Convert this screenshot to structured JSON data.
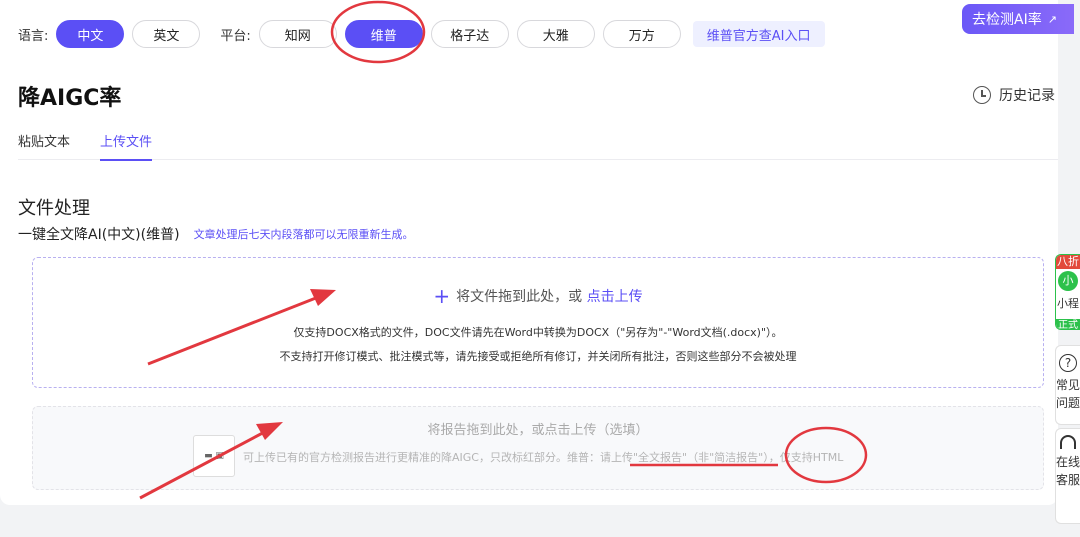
{
  "filters": {
    "language_label": "语言:",
    "languages": [
      "中文",
      "英文"
    ],
    "platform_label": "平台:",
    "platforms": [
      "知网",
      "维普",
      "格子达",
      "大雅",
      "万方"
    ],
    "official_link": "维普官方查AI入口"
  },
  "cta": {
    "label": "去检测AI率",
    "arrow": "↗"
  },
  "page": {
    "title": "降AIGC率",
    "history": "历史记录"
  },
  "tabs": [
    "粘贴文本",
    "上传文件"
  ],
  "section": {
    "title": "文件处理",
    "mode": "一键全文降AI(中文)(维普)",
    "note": "文章处理后七天内段落都可以无限重新生成。"
  },
  "upload": {
    "plus": "+",
    "prompt": "将文件拖到此处，或",
    "link": "点击上传",
    "line1": "仅支持DOCX格式的文件，DOC文件请先在Word中转换为DOCX（\"另存为\"-\"Word文档(.docx)\"）。",
    "line2": "不支持打开修订模式、批注模式等，请先接受或拒绝所有修订，并关闭所有批注，否则这些部分不会被处理"
  },
  "report": {
    "prompt": "将报告拖到此处，或点击上传（选填）",
    "line1": "可上传已有的官方检测报告进行更精准的降AIGC，只改标红部分。维普：请上传\"全文报告\"（非\"简洁报告\"），仅支持HTML",
    "icon_text": "▬ ▣"
  },
  "side": {
    "mini_tag": "八折",
    "mini_logo": "小",
    "mini_text": "小程",
    "mini_badge": "正式",
    "help_icon": "?",
    "help_text": "常见问题",
    "svc_text": "在线客服"
  }
}
